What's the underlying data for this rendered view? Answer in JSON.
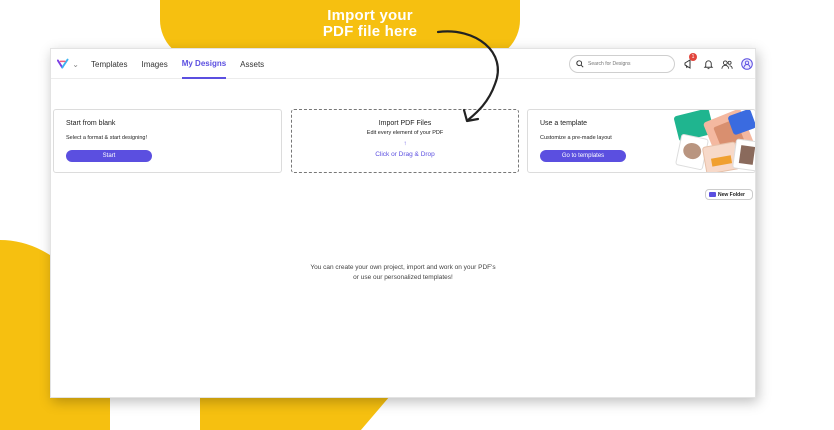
{
  "callout": {
    "line1": "Import your",
    "line2": "PDF file here"
  },
  "nav": {
    "items": [
      {
        "label": "Templates"
      },
      {
        "label": "Images"
      },
      {
        "label": "My Designs"
      },
      {
        "label": "Assets"
      }
    ],
    "active": "My Designs"
  },
  "search": {
    "placeholder": "Search for Designs"
  },
  "notifications": {
    "count": "1"
  },
  "cards": {
    "blank": {
      "title": "Start from blank",
      "subtitle": "Select a format & start designing!",
      "button": "Start"
    },
    "import": {
      "title": "Import PDF Files",
      "subtitle": "Edit every element of your PDF",
      "arrow": "↑",
      "action": "Click or Drag & Drop"
    },
    "template": {
      "title": "Use a template",
      "subtitle": "Customize a pre-made layout",
      "button": "Go to templates"
    }
  },
  "new_folder": {
    "label": "New Folder"
  },
  "empty_state": {
    "line1": "You can create your own project, import and work on your PDF's",
    "line2": "or use our personalized templates!"
  },
  "colors": {
    "accent": "#5b4fe0",
    "highlight": "#f6c010",
    "badge": "#e2453c"
  }
}
